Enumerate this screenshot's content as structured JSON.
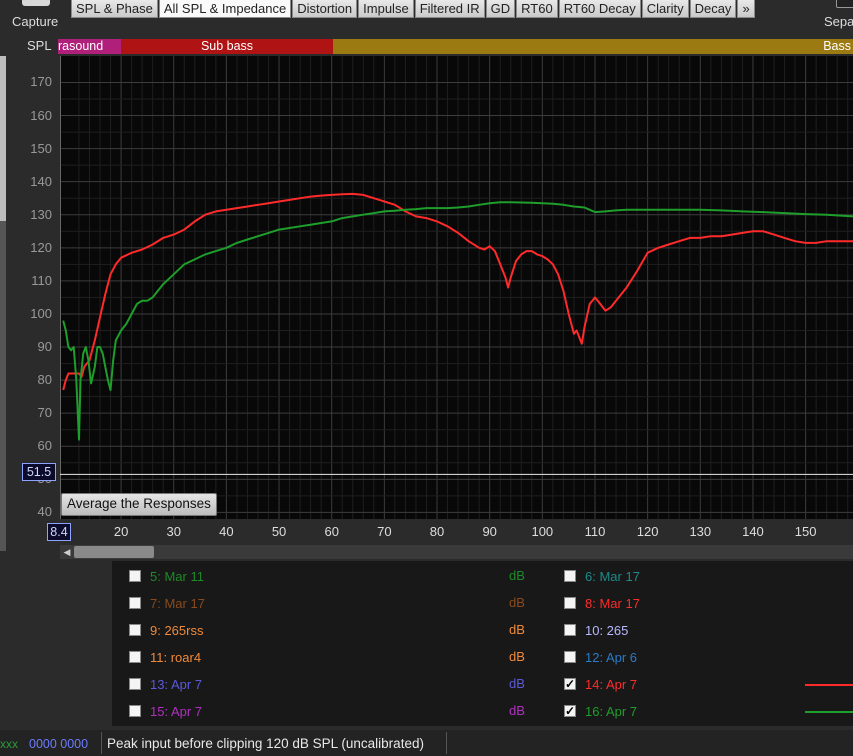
{
  "toolbar": {
    "capture_label": "Capture",
    "tabs": [
      "SPL & Phase",
      "All SPL & Impedance",
      "Distortion",
      "Impulse",
      "Filtered IR",
      "GD",
      "RT60",
      "RT60 Decay",
      "Clarity",
      "Decay",
      "»"
    ],
    "active_tab": "All SPL & Impedance",
    "sepa_label": "Sepa"
  },
  "graph": {
    "y_axis_label": "SPL",
    "bands": [
      {
        "label": "rasound",
        "color": "#b01f7a"
      },
      {
        "label": "Sub bass",
        "color": "#b01313"
      },
      {
        "label": "Bass",
        "color": "#9c7a12"
      }
    ],
    "y_ticks": [
      "170",
      "160",
      "150",
      "140",
      "130",
      "120",
      "110",
      "100",
      "90",
      "80",
      "70",
      "60",
      "50",
      "40"
    ],
    "x_ticks": [
      "20",
      "30",
      "40",
      "50",
      "60",
      "70",
      "80",
      "90",
      "100",
      "110",
      "120",
      "130",
      "140",
      "150"
    ],
    "cursor_y": "51.5",
    "cursor_x": "8.4",
    "average_button": "Average the Responses"
  },
  "chart_data": {
    "type": "line",
    "xlabel": "",
    "ylabel": "SPL",
    "xlim": [
      8.4,
      159
    ],
    "ylim": [
      38,
      178
    ],
    "grid": true,
    "cursor": {
      "x": 8.4,
      "y": 51.5
    },
    "series": [
      {
        "name": "14: Apr 7",
        "color": "#ff2a2a",
        "points": [
          [
            9.0,
            77
          ],
          [
            9.5,
            80
          ],
          [
            10,
            82
          ],
          [
            11,
            82
          ],
          [
            12,
            82
          ],
          [
            12.5,
            81
          ],
          [
            13,
            84
          ],
          [
            14,
            86
          ],
          [
            15,
            92
          ],
          [
            16,
            99
          ],
          [
            17,
            106
          ],
          [
            18,
            112
          ],
          [
            19,
            115
          ],
          [
            20,
            117
          ],
          [
            22,
            118.5
          ],
          [
            24,
            119.5
          ],
          [
            26,
            121
          ],
          [
            28,
            123
          ],
          [
            30,
            124
          ],
          [
            32,
            125.5
          ],
          [
            34,
            128
          ],
          [
            36,
            130
          ],
          [
            38,
            131
          ],
          [
            40,
            131.5
          ],
          [
            42,
            132
          ],
          [
            44,
            132.5
          ],
          [
            46,
            133
          ],
          [
            48,
            133.5
          ],
          [
            50,
            134
          ],
          [
            52,
            134.5
          ],
          [
            54,
            135
          ],
          [
            56,
            135.5
          ],
          [
            58,
            135.8
          ],
          [
            60,
            136
          ],
          [
            62,
            136.2
          ],
          [
            64,
            136.3
          ],
          [
            66,
            136
          ],
          [
            68,
            135
          ],
          [
            70,
            134
          ],
          [
            72,
            133
          ],
          [
            74,
            131
          ],
          [
            76,
            129.5
          ],
          [
            78,
            129
          ],
          [
            80,
            128
          ],
          [
            82,
            126.5
          ],
          [
            84,
            124.5
          ],
          [
            86,
            122
          ],
          [
            88,
            120
          ],
          [
            89,
            119.5
          ],
          [
            90,
            120.5
          ],
          [
            91,
            119
          ],
          [
            92,
            115
          ],
          [
            93,
            111
          ],
          [
            93.5,
            108
          ],
          [
            94,
            111
          ],
          [
            95,
            116
          ],
          [
            96,
            118
          ],
          [
            97,
            119
          ],
          [
            98,
            119
          ],
          [
            99,
            118
          ],
          [
            100,
            117.5
          ],
          [
            101,
            116.5
          ],
          [
            102,
            115
          ],
          [
            103,
            112
          ],
          [
            104,
            107
          ],
          [
            105,
            100
          ],
          [
            106,
            94
          ],
          [
            106.5,
            95
          ],
          [
            107,
            93
          ],
          [
            107.5,
            91
          ],
          [
            108,
            96
          ],
          [
            109,
            103
          ],
          [
            110,
            105
          ],
          [
            111,
            103
          ],
          [
            112,
            101
          ],
          [
            113,
            102
          ],
          [
            114,
            104
          ],
          [
            116,
            108
          ],
          [
            118,
            113
          ],
          [
            120,
            118.5
          ],
          [
            122,
            120
          ],
          [
            124,
            121
          ],
          [
            126,
            122
          ],
          [
            128,
            123
          ],
          [
            130,
            123
          ],
          [
            132,
            123.5
          ],
          [
            134,
            123.5
          ],
          [
            136,
            124
          ],
          [
            138,
            124.5
          ],
          [
            140,
            125
          ],
          [
            142,
            125
          ],
          [
            144,
            124
          ],
          [
            146,
            123
          ],
          [
            148,
            122
          ],
          [
            150,
            121.5
          ],
          [
            152,
            121.5
          ],
          [
            154,
            122
          ],
          [
            156,
            122
          ],
          [
            159,
            122
          ]
        ]
      },
      {
        "name": "16: Apr 7",
        "color": "#1e9e2a",
        "points": [
          [
            9.0,
            98
          ],
          [
            9.5,
            95
          ],
          [
            10,
            90
          ],
          [
            10.5,
            89
          ],
          [
            11,
            90
          ],
          [
            11.5,
            80
          ],
          [
            12,
            62
          ],
          [
            12.3,
            80
          ],
          [
            12.8,
            88
          ],
          [
            13.3,
            90
          ],
          [
            13.8,
            86
          ],
          [
            14.3,
            79
          ],
          [
            15,
            84
          ],
          [
            15.5,
            90
          ],
          [
            16,
            90
          ],
          [
            16.5,
            88
          ],
          [
            17,
            84
          ],
          [
            17.5,
            80
          ],
          [
            18,
            77
          ],
          [
            18.5,
            86
          ],
          [
            19,
            92
          ],
          [
            20,
            95
          ],
          [
            21,
            97
          ],
          [
            22,
            100
          ],
          [
            23,
            103
          ],
          [
            24,
            104
          ],
          [
            25,
            104
          ],
          [
            26,
            105
          ],
          [
            27,
            107
          ],
          [
            28,
            109
          ],
          [
            30,
            112
          ],
          [
            32,
            115
          ],
          [
            34,
            116.5
          ],
          [
            36,
            118
          ],
          [
            38,
            119
          ],
          [
            40,
            120
          ],
          [
            42,
            121.5
          ],
          [
            44,
            122.5
          ],
          [
            46,
            123.5
          ],
          [
            48,
            124.5
          ],
          [
            50,
            125.5
          ],
          [
            52,
            126
          ],
          [
            54,
            126.5
          ],
          [
            56,
            127
          ],
          [
            58,
            127.5
          ],
          [
            60,
            128
          ],
          [
            62,
            129
          ],
          [
            64,
            129.5
          ],
          [
            66,
            130
          ],
          [
            68,
            130.5
          ],
          [
            70,
            131
          ],
          [
            72,
            131.2
          ],
          [
            74,
            131.5
          ],
          [
            76,
            131.7
          ],
          [
            78,
            132
          ],
          [
            80,
            132
          ],
          [
            82,
            132
          ],
          [
            84,
            132.2
          ],
          [
            86,
            132.5
          ],
          [
            88,
            133
          ],
          [
            90,
            133.5
          ],
          [
            92,
            133.8
          ],
          [
            94,
            133.8
          ],
          [
            96,
            133.7
          ],
          [
            98,
            133.6
          ],
          [
            100,
            133.5
          ],
          [
            102,
            133.3
          ],
          [
            104,
            133
          ],
          [
            106,
            132.5
          ],
          [
            108,
            132.2
          ],
          [
            109,
            131.5
          ],
          [
            110,
            130.8
          ],
          [
            112,
            131
          ],
          [
            114,
            131.3
          ],
          [
            116,
            131.5
          ],
          [
            118,
            131.5
          ],
          [
            120,
            131.5
          ],
          [
            122,
            131.5
          ],
          [
            126,
            131.5
          ],
          [
            130,
            131.5
          ],
          [
            134,
            131.3
          ],
          [
            138,
            131
          ],
          [
            142,
            130.8
          ],
          [
            146,
            130.5
          ],
          [
            150,
            130.2
          ],
          [
            154,
            130
          ],
          [
            159,
            129.5
          ]
        ]
      }
    ]
  },
  "legend": {
    "items": [
      {
        "label": "5: Mar 11",
        "unit": "dB",
        "color": "#1e8a28",
        "checked": false,
        "col": 0,
        "row": 0
      },
      {
        "label": "6: Mar 17",
        "unit": "",
        "color": "#1d8a8a",
        "checked": false,
        "col": 1,
        "row": 0
      },
      {
        "label": "7: Mar 17",
        "unit": "dB",
        "color": "#8a4a1d",
        "checked": false,
        "col": 0,
        "row": 1
      },
      {
        "label": "8: Mar 17",
        "unit": "",
        "color": "#ff2a2a",
        "checked": false,
        "col": 1,
        "row": 1
      },
      {
        "label": "9: 265rss",
        "unit": "dB",
        "color": "#f08a3a",
        "checked": false,
        "col": 0,
        "row": 2
      },
      {
        "label": "10: 265",
        "unit": "",
        "color": "#b8b8ff",
        "checked": false,
        "col": 1,
        "row": 2
      },
      {
        "label": "11: roar4",
        "unit": "dB",
        "color": "#f08a3a",
        "checked": false,
        "col": 0,
        "row": 3
      },
      {
        "label": "12: Apr 6",
        "unit": "",
        "color": "#2a7ac8",
        "checked": false,
        "col": 1,
        "row": 3
      },
      {
        "label": "13: Apr 7",
        "unit": "dB",
        "color": "#5a5ad8",
        "checked": false,
        "col": 0,
        "row": 4
      },
      {
        "label": "14: Apr 7",
        "unit": "",
        "color": "#ff2a2a",
        "checked": true,
        "col": 1,
        "row": 4,
        "line": "#ff2a2a"
      },
      {
        "label": "15: Apr 7",
        "unit": "dB",
        "color": "#b030c0",
        "checked": false,
        "col": 0,
        "row": 5
      },
      {
        "label": "16: Apr 7",
        "unit": "",
        "color": "#1e9e2a",
        "checked": true,
        "col": 1,
        "row": 5,
        "line": "#1e9e2a"
      }
    ]
  },
  "status": {
    "xx": "xxx",
    "code": "0000 0000",
    "peak": "Peak input before clipping 120 dB SPL (uncalibrated)"
  }
}
